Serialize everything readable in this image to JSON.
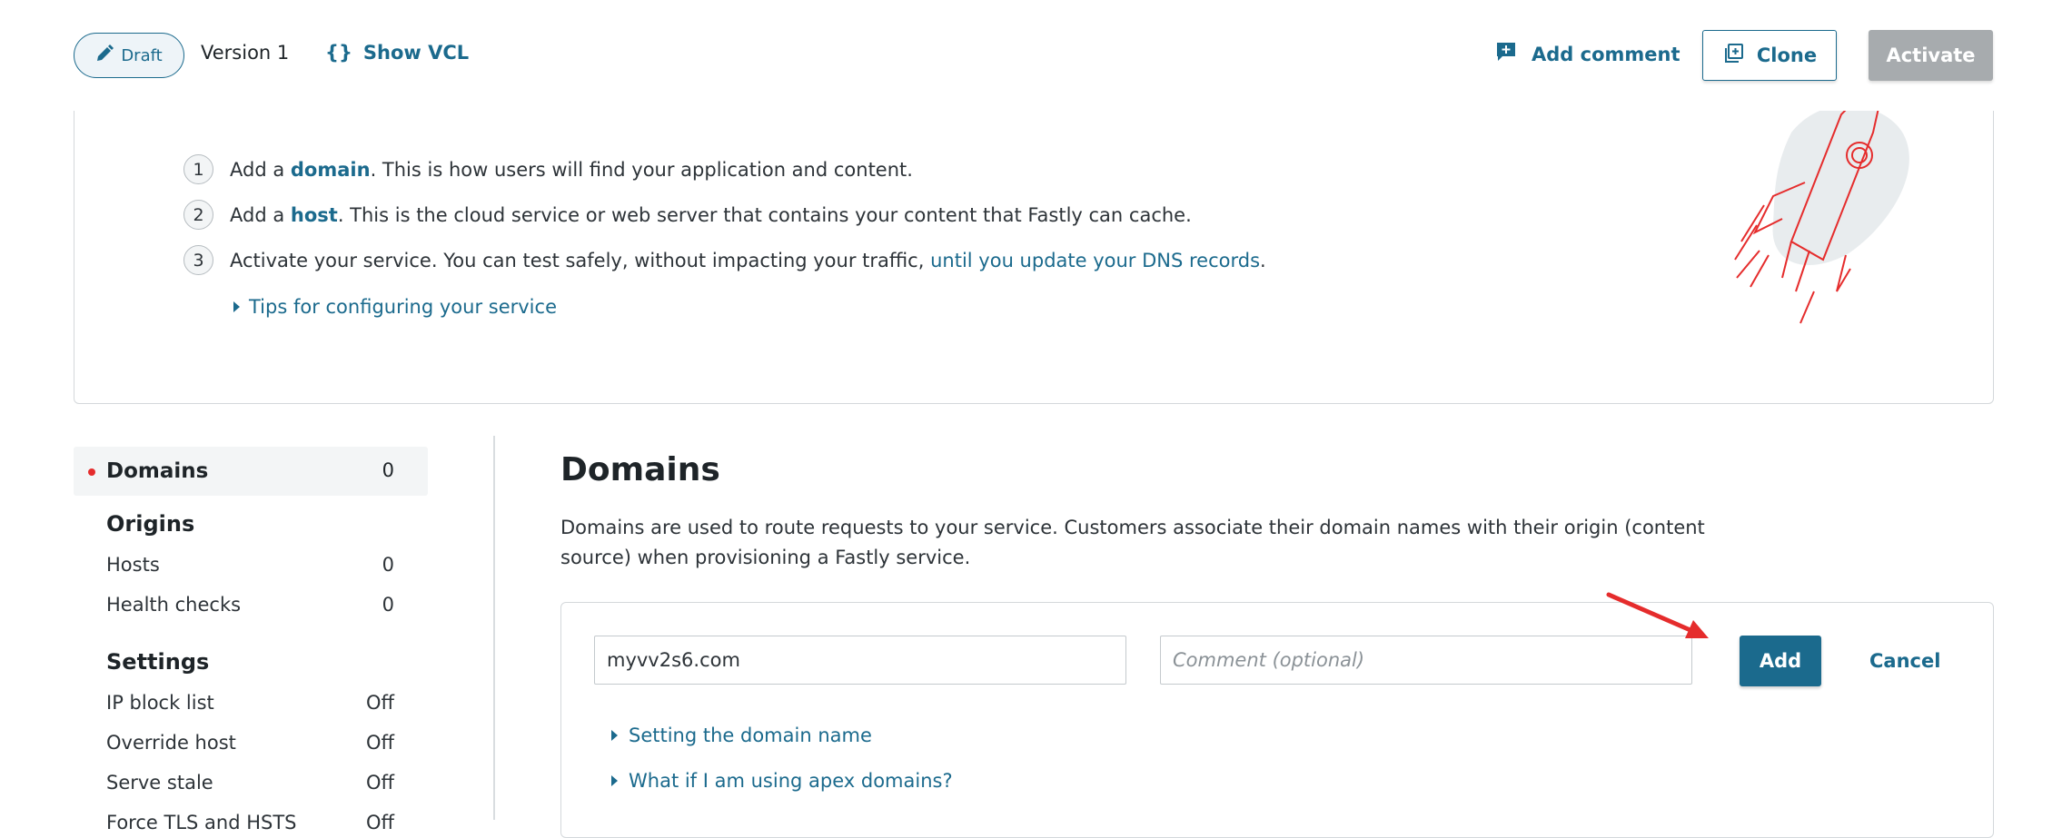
{
  "toolbar": {
    "draft_label": "Draft",
    "version_label": "Version 1",
    "show_vcl_label": "Show VCL",
    "add_comment_label": "Add comment",
    "clone_label": "Clone",
    "activate_label": "Activate"
  },
  "getting_started": {
    "steps": [
      {
        "number": "1",
        "pre": "Add a ",
        "link": "domain",
        "post": ". This is how users will find your application and content."
      },
      {
        "number": "2",
        "pre": "Add a ",
        "link": "host",
        "post": ". This is the cloud service or web server that contains your content that Fastly can cache."
      },
      {
        "number": "3",
        "pre": "Activate your service. You can test safely, without impacting your traffic, ",
        "link": "until you update your DNS records",
        "post": "."
      }
    ],
    "tips_label": "Tips for configuring your service"
  },
  "nav": {
    "domains": {
      "label": "Domains",
      "count": "0"
    },
    "origins_heading": "Origins",
    "hosts": {
      "label": "Hosts",
      "count": "0"
    },
    "health_checks": {
      "label": "Health checks",
      "count": "0"
    },
    "settings_heading": "Settings",
    "ip_block_list": {
      "label": "IP block list",
      "value": "Off"
    },
    "override_host": {
      "label": "Override host",
      "value": "Off"
    },
    "serve_stale": {
      "label": "Serve stale",
      "value": "Off"
    },
    "force_tls": {
      "label": "Force TLS and HSTS",
      "value": "Off"
    }
  },
  "main": {
    "title": "Domains",
    "description": "Domains are used to route requests to your service. Customers associate their domain names with their origin (content source) when provisioning a Fastly service.",
    "domain_input_value": "myvv2s6.com",
    "comment_placeholder": "Comment (optional)",
    "add_label": "Add",
    "cancel_label": "Cancel",
    "help_links": [
      "Setting the domain name",
      "What if I am using apex domains?"
    ]
  },
  "colors": {
    "accent": "#1b6a8d",
    "disabled_button": "#a7abae",
    "annotation_arrow": "#e52c2c"
  }
}
